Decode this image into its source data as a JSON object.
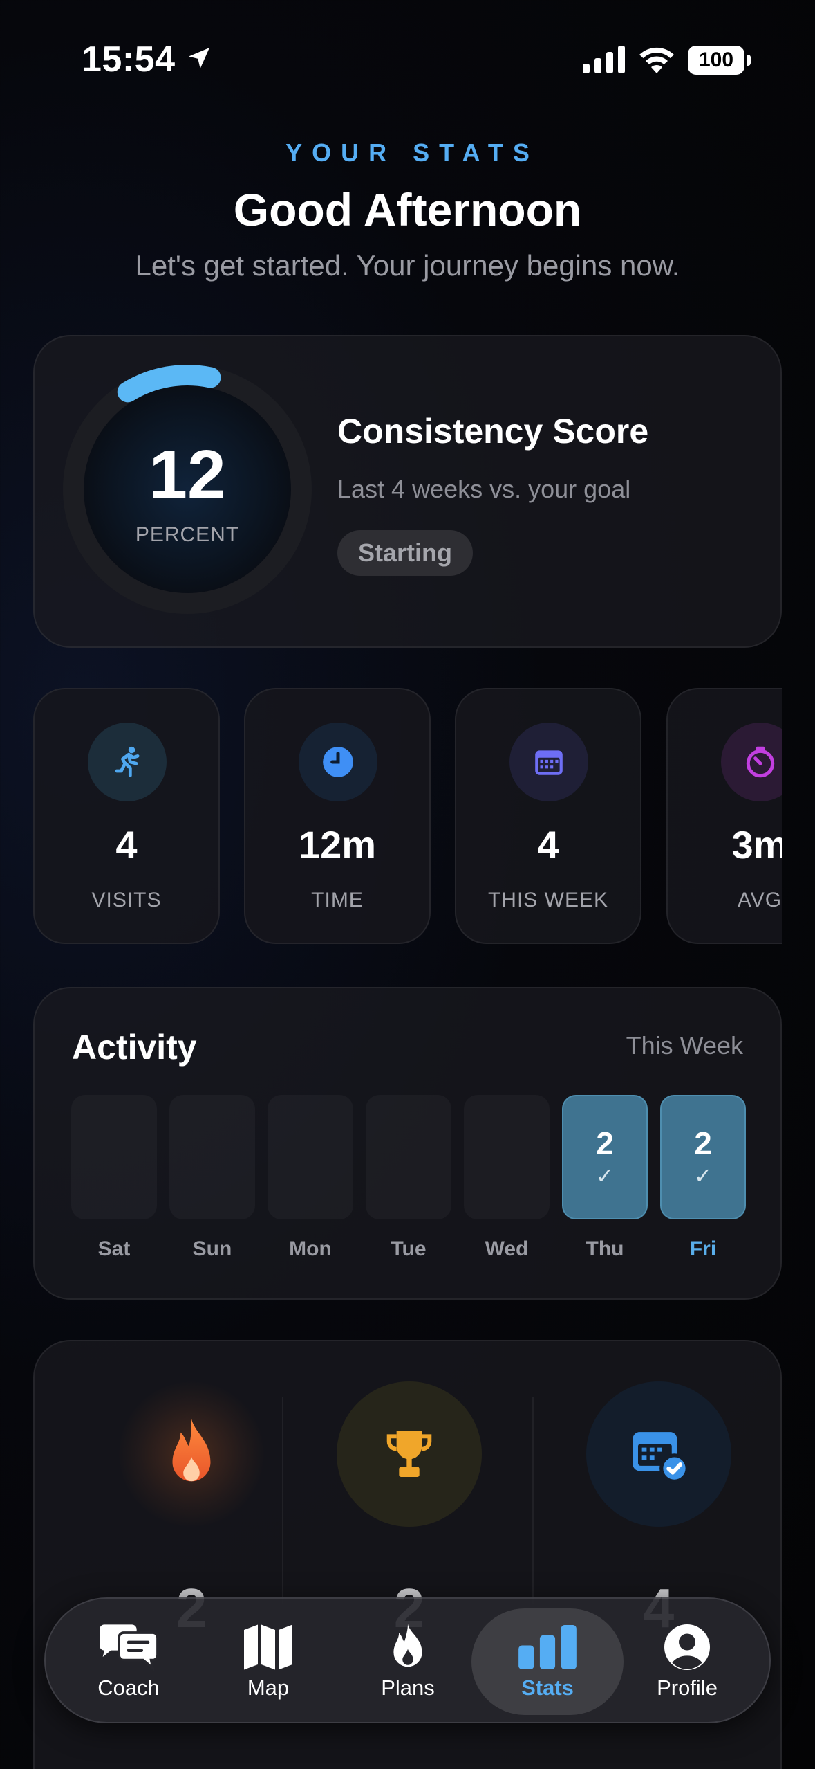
{
  "status_bar": {
    "time": "15:54",
    "battery": "100"
  },
  "header": {
    "eyebrow": "YOUR STATS",
    "greeting": "Good Afternoon",
    "subtitle": "Let's get started. Your journey begins now."
  },
  "consistency": {
    "value": "12",
    "unit": "PERCENT",
    "progress": 0.12,
    "title": "Consistency Score",
    "subtitle": "Last 4 weeks vs. your goal",
    "badge": "Starting",
    "accent": "#5bb8f5"
  },
  "stat_tiles": [
    {
      "icon": "running-icon",
      "value": "4",
      "label": "VISITS",
      "color": "#4fa8f0"
    },
    {
      "icon": "clock-icon",
      "value": "12m",
      "label": "TIME",
      "color": "#3f8ff5"
    },
    {
      "icon": "calendar-icon",
      "value": "4",
      "label": "THIS WEEK",
      "color": "#6e6ef5"
    },
    {
      "icon": "timer-icon",
      "value": "3m",
      "label": "AVG",
      "color": "#c23fe0"
    }
  ],
  "activity": {
    "title": "Activity",
    "range": "This Week",
    "days": [
      {
        "label": "Sat",
        "count": "",
        "check": ""
      },
      {
        "label": "Sun",
        "count": "",
        "check": ""
      },
      {
        "label": "Mon",
        "count": "",
        "check": ""
      },
      {
        "label": "Tue",
        "count": "",
        "check": ""
      },
      {
        "label": "Wed",
        "count": "",
        "check": ""
      },
      {
        "label": "Thu",
        "count": "2",
        "check": "✓"
      },
      {
        "label": "Fri",
        "count": "2",
        "check": "✓"
      }
    ]
  },
  "streaks": [
    {
      "icon": "flame-icon",
      "value": "2"
    },
    {
      "icon": "trophy-icon",
      "value": "2"
    },
    {
      "icon": "calendar-check-icon",
      "value": "4"
    }
  ],
  "tab_bar": {
    "tabs": [
      {
        "label": "Coach",
        "icon": "chat-bubbles-icon"
      },
      {
        "label": "Map",
        "icon": "map-icon"
      },
      {
        "label": "Plans",
        "icon": "flame-drop-icon"
      },
      {
        "label": "Stats",
        "icon": "bar-chart-icon",
        "active": true
      },
      {
        "label": "Profile",
        "icon": "person-circle-icon"
      }
    ]
  },
  "colors": {
    "accent": "#55adf3",
    "active_day": "#3f7390"
  }
}
